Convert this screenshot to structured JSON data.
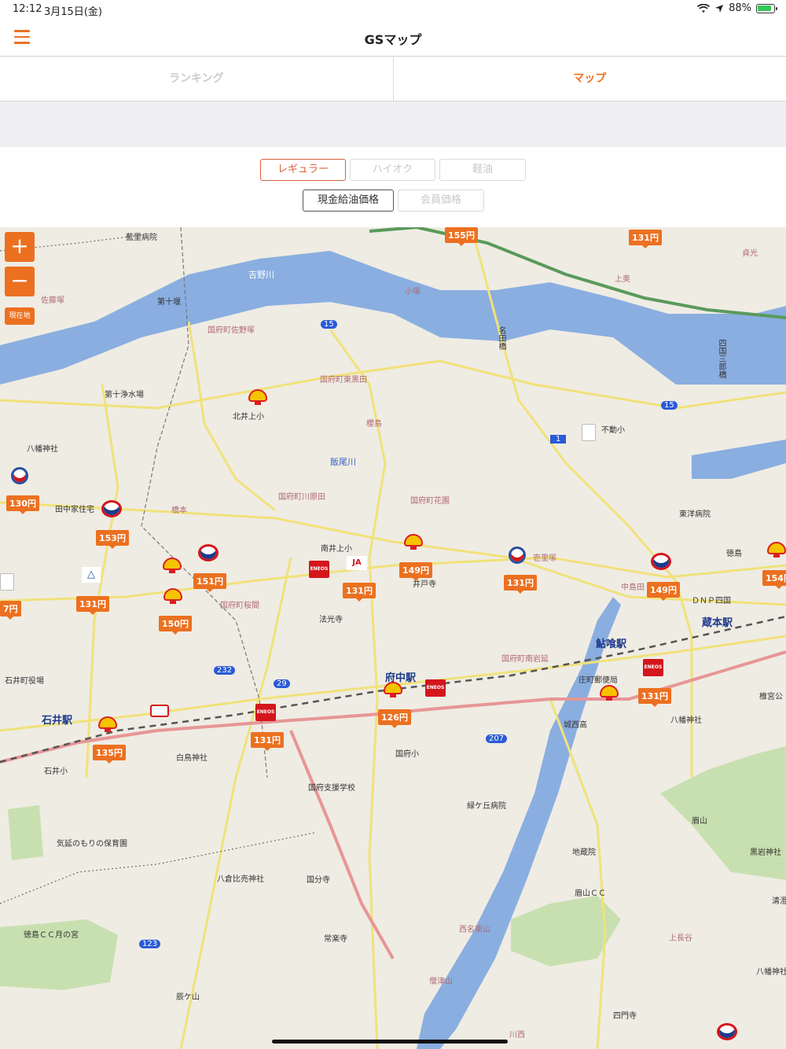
{
  "status": {
    "time": "12:12",
    "date": "3月15日(金)",
    "battery": "88%",
    "battery_level": 0.88,
    "icons": [
      "wifi-icon",
      "location-arrow-icon",
      "battery-icon"
    ]
  },
  "nav": {
    "title": "GSマップ",
    "menu_icon": "hamburger-menu-icon"
  },
  "tabs": [
    {
      "label": "ランキング",
      "active": false
    },
    {
      "label": "マップ",
      "active": true
    }
  ],
  "fuel_filters": [
    {
      "label": "レギュラー",
      "selected": true
    },
    {
      "label": "ハイオク",
      "selected": false
    },
    {
      "label": "軽油",
      "selected": false
    }
  ],
  "price_filters": [
    {
      "label": "現金給油価格",
      "selected": true
    },
    {
      "label": "会員価格",
      "selected": false
    }
  ],
  "colors": {
    "accent": "#ec7020",
    "regular_border": "#d9603a"
  },
  "map_controls": {
    "zoom_in": "+",
    "zoom_out": "−",
    "current_location": "現在地"
  },
  "prices": [
    "155円",
    "131円",
    "130円",
    "153円",
    "151円",
    "131円",
    "131円",
    "149円",
    "131円",
    "149円",
    "154円",
    "150円",
    "7円",
    "131円",
    "126円",
    "131円",
    "135円"
  ],
  "places": {
    "airi_hospital": "藍里病院",
    "satozuka": "佐藤塚",
    "dai10": "第十堰",
    "yoshino_river": "吉野川",
    "kozuka": "小塚",
    "kamioku": "上奥",
    "sadamitsu": "貞光",
    "sanoduka": "国府町佐野塚",
    "r15a": "15",
    "nadabashi": "名田橋",
    "shikokusabuchi": "四国三郎橋",
    "higashikuroda": "国府町東黒田",
    "jusu": "第十浄水場",
    "kitaiua": "北井上小",
    "sakurajima": "櫻島",
    "r15b": "15",
    "r1": "1",
    "fudo": "不動小",
    "hachiman1": "八幡神社",
    "iioriver": "飯尾川",
    "kawaharada": "国府町川原田",
    "hanazono": "国府町花園",
    "tanaka": "田中家住宅",
    "hashimoto": "橋本",
    "toyo": "東洋病院",
    "minamiiua": "南井上小",
    "tokushima": "徳島",
    "iryuji": "井戸寺",
    "iritsuka": "壱里塚",
    "nakashima": "中島田",
    "dnp": "ＤＮＰ四国",
    "kuramoto": "蔵本駅",
    "sakurama": "国府町桜間",
    "hokoji": "法光寺",
    "ayukui": "鮎喰駅",
    "minamiiwanobu": "国府町南岩延",
    "shoumachi_po": "庄町郵便局",
    "r232": "232",
    "ishii_office": "石井町役場",
    "r29": "29",
    "fuchu": "府中駅",
    "ishii_station": "石井駅",
    "hachiman2": "八幡神社",
    "kamiya": "椎宮公",
    "shiratori": "白鳥神社",
    "jonishi": "城西高",
    "r207": "207",
    "kokufusho": "国府小",
    "ishiisho": "石井小",
    "shiengakko": "国府支援学校",
    "midorigaoka": "緑ケ丘病院",
    "bizan": "眉山",
    "kienomori": "気延のもりの保育園",
    "jizoin": "地蔵院",
    "kuroiwa": "黒岩神社",
    "yakura": "八倉比売神社",
    "kokubunji": "国分寺",
    "bizancc": "眉山ＣＣ",
    "kiyosumi": "清澄",
    "tokushimacc": "徳島ＣＣ月の宮",
    "r123": "123",
    "jorakuji": "常楽寺",
    "nishimeitozan": "西名東山",
    "kamiegoku": "上長谷",
    "sozu": "僧津山",
    "hachiman3": "八幡神社",
    "tatsugayama": "辰ケ山",
    "shimonji": "四門寺",
    "kawanishi": "川西"
  }
}
